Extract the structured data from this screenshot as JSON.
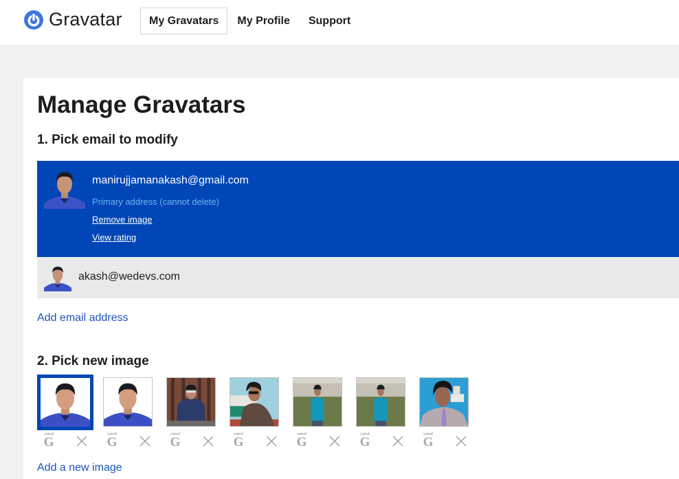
{
  "header": {
    "logo_text": "Gravatar",
    "brand_color": "#3d77e0",
    "nav": [
      {
        "label": "My Gravatars",
        "active": true
      },
      {
        "label": "My Profile",
        "active": false
      },
      {
        "label": "Support",
        "active": false
      }
    ]
  },
  "main": {
    "title": "Manage Gravatars",
    "section1_title": "1. Pick email to modify",
    "emails": [
      {
        "address": "manirujjamanakash@gmail.com",
        "selected": true,
        "note": "Primary address (cannot delete)",
        "links": [
          "Remove image",
          "View rating"
        ]
      },
      {
        "address": "akash@wedevs.com",
        "selected": false
      }
    ],
    "add_email_label": "Add email address",
    "section2_title": "2. Pick new image",
    "images": [
      {
        "description": "portrait-blue-shirt-white-bg",
        "selected": true,
        "rating": "G"
      },
      {
        "description": "portrait-blue-shirt-white-bg",
        "selected": false,
        "rating": "G"
      },
      {
        "description": "seated-sunglasses-brick-wall",
        "selected": false,
        "rating": "G"
      },
      {
        "description": "sunglasses-outdoor-building",
        "selected": false,
        "rating": "G"
      },
      {
        "description": "teal-shirt-grass-building",
        "selected": false,
        "rating": "G"
      },
      {
        "description": "teal-shirt-grass-building",
        "selected": false,
        "rating": "G"
      },
      {
        "description": "striped-shirt-blue-wall",
        "selected": false,
        "rating": "G"
      }
    ],
    "rating_small_label": "rated",
    "add_image_label": "Add a new image",
    "selected_color": "#0046b6"
  }
}
